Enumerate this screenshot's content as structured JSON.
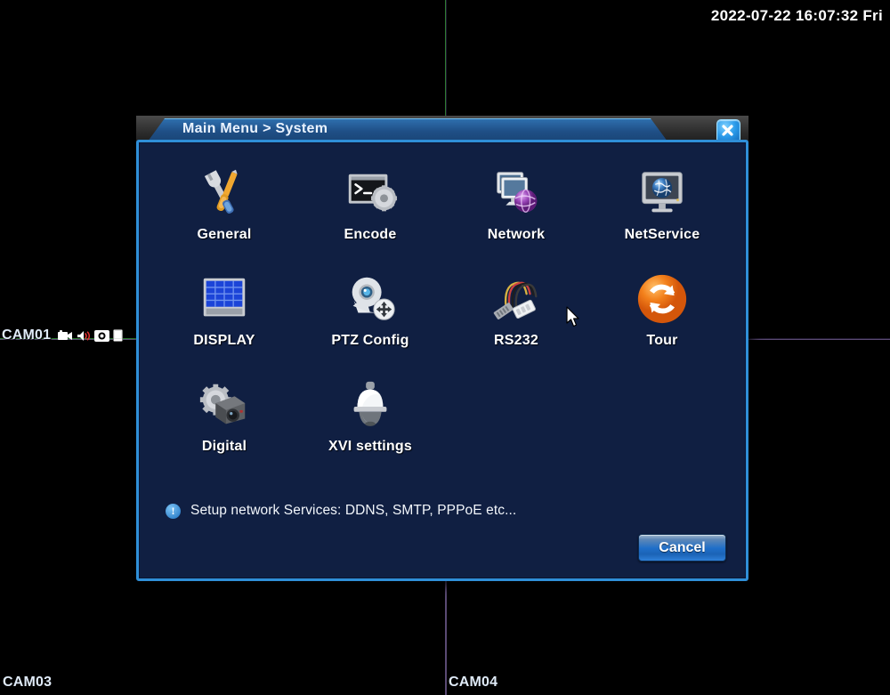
{
  "overlay": {
    "timestamp": "2022-07-22 16:07:32 Fri"
  },
  "video_wall": {
    "channels": [
      {
        "label": "CAM01",
        "border_color": "#2e7d32",
        "status_icons": [
          "video-camera-icon",
          "audio-speaker-icon",
          "record-circle-icon",
          "document-icon"
        ]
      },
      {
        "label": "",
        "border_color": "#221a33",
        "status_icons": []
      },
      {
        "label": "CAM03",
        "border_color": "#5a4a73",
        "status_icons": []
      },
      {
        "label": "CAM04",
        "border_color": "#5a4a73",
        "status_icons": []
      }
    ]
  },
  "dialog": {
    "title": "Main Menu > System",
    "close_label": "x",
    "menu_items": [
      {
        "label": "General",
        "icon": "wrench-screwdriver-icon"
      },
      {
        "label": "Encode",
        "icon": "terminal-gear-icon"
      },
      {
        "label": "Network",
        "icon": "monitors-globe-icon"
      },
      {
        "label": "NetService",
        "icon": "monitor-globe-icon"
      },
      {
        "label": "DISPLAY",
        "icon": "grid-screen-icon"
      },
      {
        "label": "PTZ Config",
        "icon": "dome-camera-move-icon"
      },
      {
        "label": "RS232",
        "icon": "serial-cable-icon"
      },
      {
        "label": "Tour",
        "icon": "refresh-cycle-icon"
      },
      {
        "label": "Digital",
        "icon": "gear-camera-icon"
      },
      {
        "label": "XVI settings",
        "icon": "dome-camera-icon"
      }
    ],
    "hint": {
      "icon": "info-exclamation-icon",
      "text": "Setup network Services: DDNS, SMTP, PPPoE etc..."
    },
    "cancel_label": "Cancel"
  },
  "colors": {
    "dialog_border": "#2f8fd8",
    "dialog_body": "#101f42",
    "title_bar": "#1f4f86",
    "accent_orange": "#f07d1a",
    "active_channel_border": "#2e7d32"
  }
}
